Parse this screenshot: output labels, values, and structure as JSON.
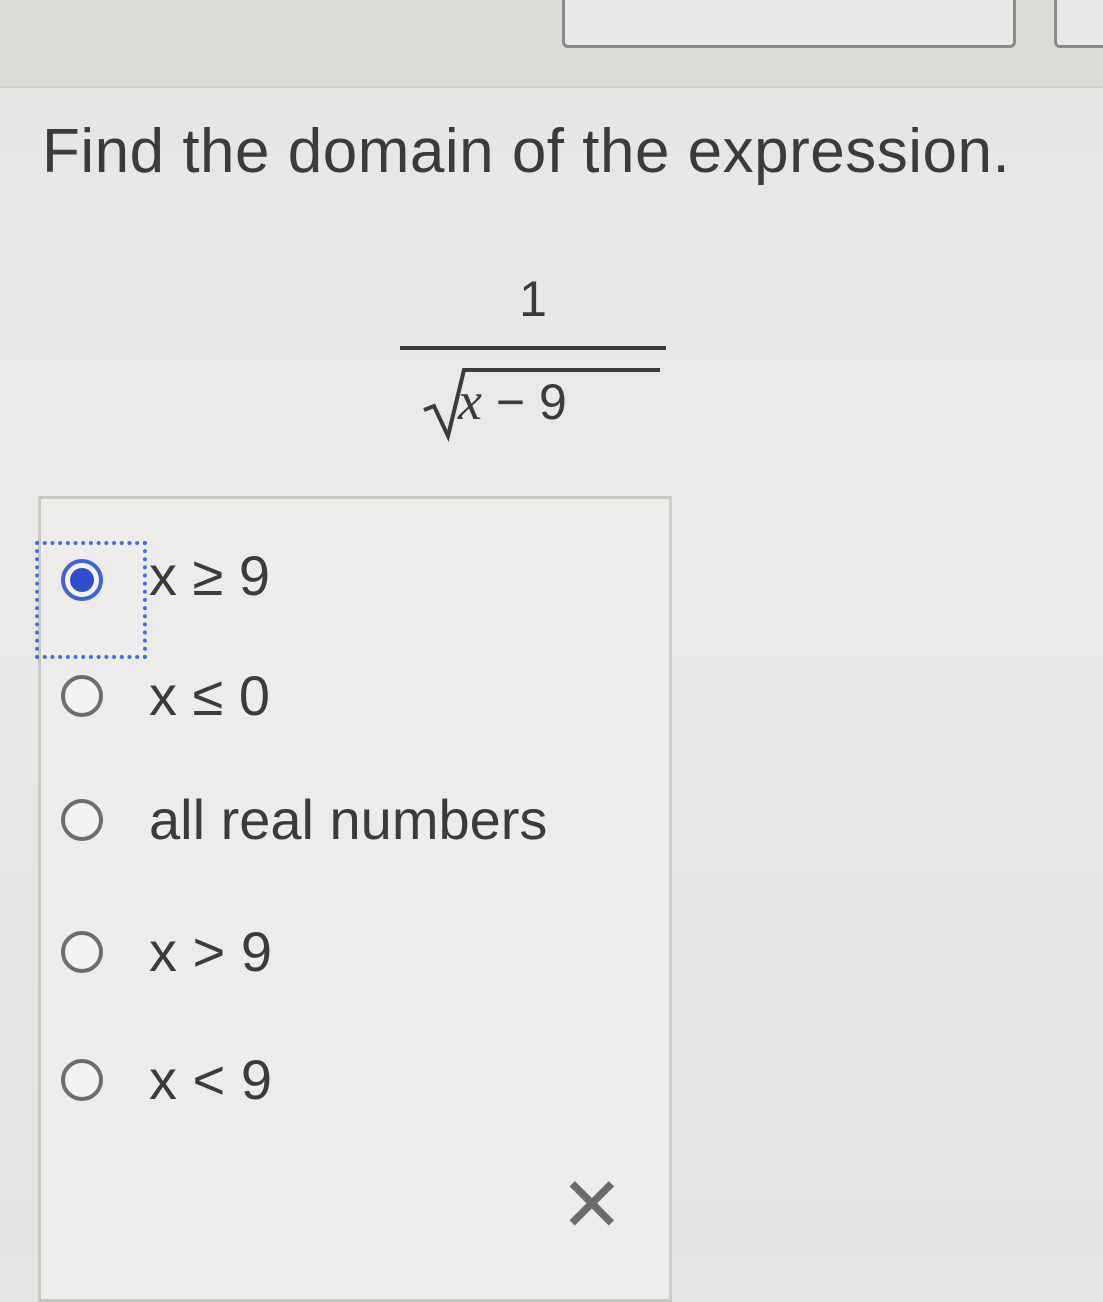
{
  "question": {
    "prompt": "Find the domain of the expression."
  },
  "expression": {
    "numerator": "1",
    "radicand_var": "x",
    "radicand_rest": " − 9"
  },
  "options": [
    {
      "label": "x ≥ 9",
      "selected": true
    },
    {
      "label": "x ≤ 0",
      "selected": false
    },
    {
      "label": "all real numbers",
      "selected": false
    },
    {
      "label": "x > 9",
      "selected": false
    },
    {
      "label": "x < 9",
      "selected": false
    }
  ],
  "result": {
    "mark": "✕"
  },
  "colors": {
    "selected_radio": "#2f4ed0",
    "focus_ring": "#4a6fd8",
    "text": "#3b3b3b"
  }
}
